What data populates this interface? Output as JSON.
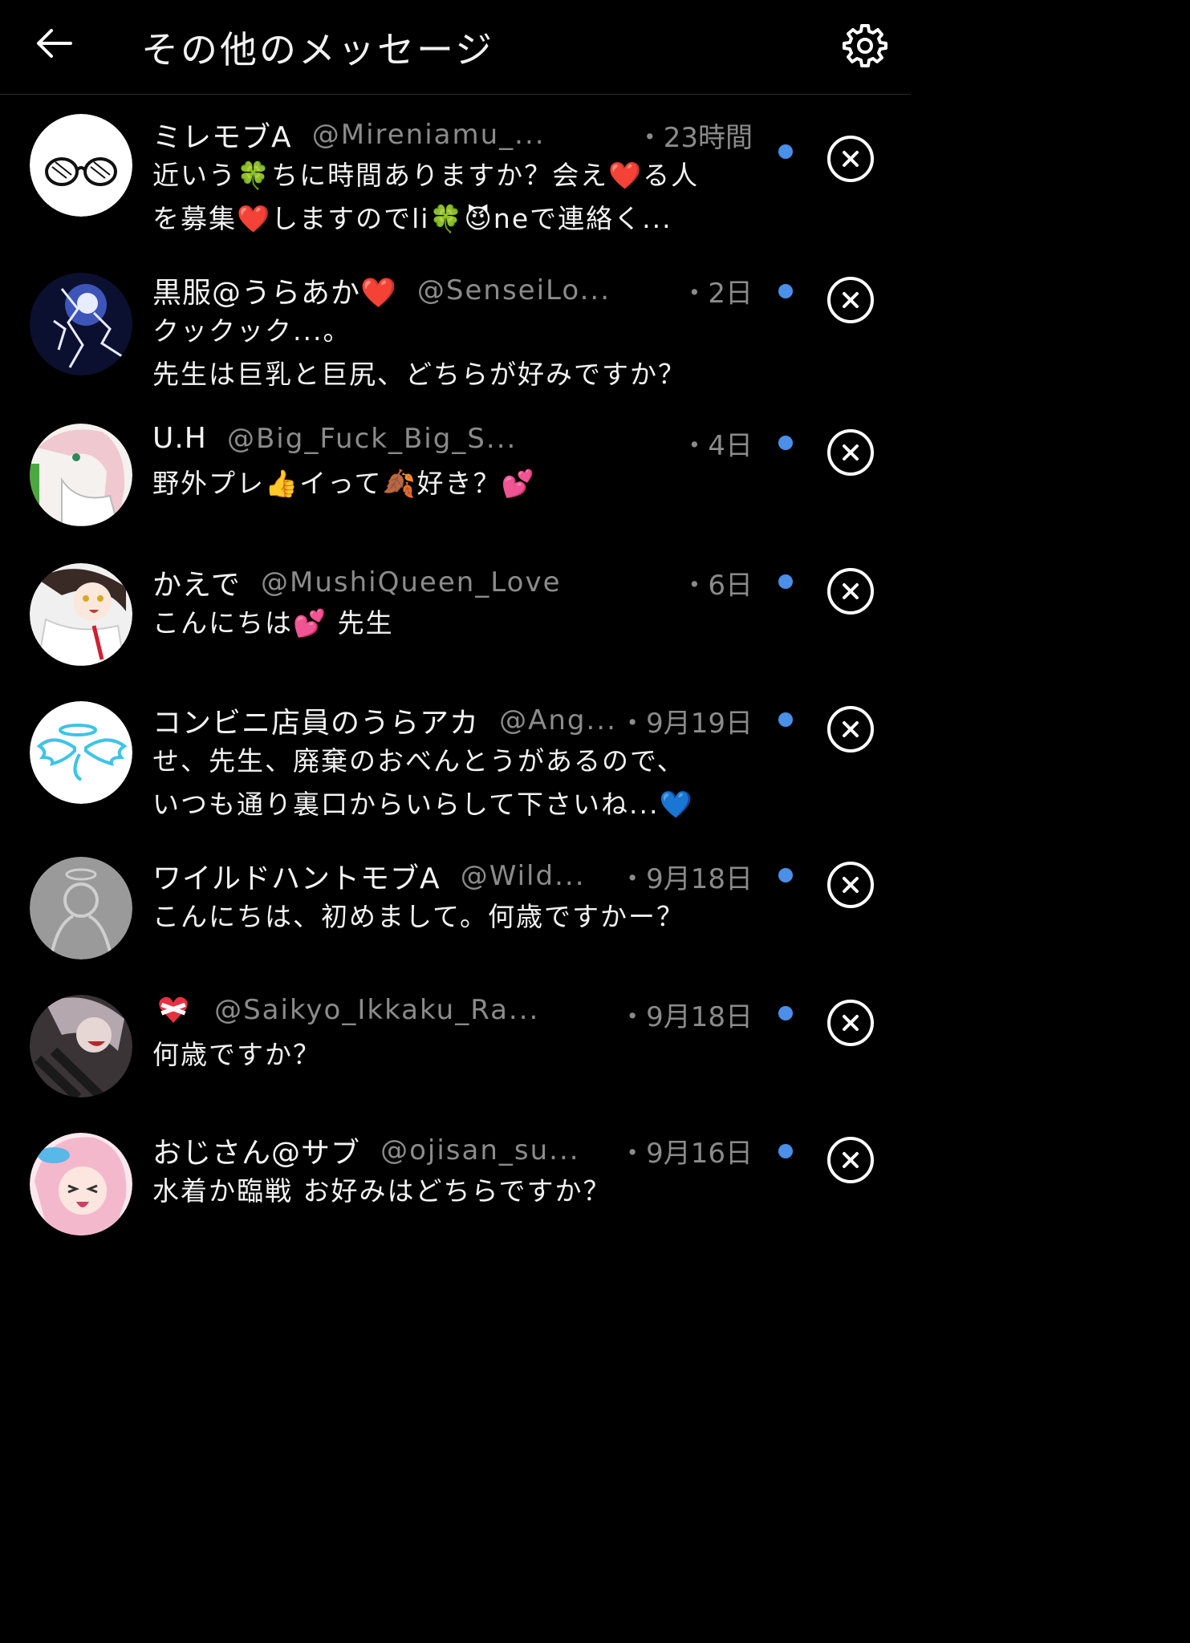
{
  "header": {
    "title": "その他のメッセージ"
  },
  "messages": [
    {
      "name": "ミレモブA",
      "handle": "@Mireniamu_...",
      "time": "・23時間",
      "lines": [
        "近いう🍀ちに時間ありますか？会え❤️る人",
        "を募集❤️しますのでli🍀😈neで連絡く..."
      ]
    },
    {
      "name": "黒服@うらあか❤️",
      "handle": "@SenseiLo...",
      "time": "・2日",
      "lines": [
        "クックック...。",
        "先生は巨乳と巨尻、どちらが好みですか？"
      ]
    },
    {
      "name": "U.H",
      "handle": "@Big_Fuck_Big_S...",
      "time": "・4日",
      "lines": [
        "野外プレ👍イって🍂好き？💕"
      ]
    },
    {
      "name": "かえで",
      "handle": "@MushiQueen_Love",
      "time": "・6日",
      "lines": [
        "こんにちは💕 先生"
      ]
    },
    {
      "name": "コンビニ店員のうらアカ",
      "handle": "@Ang...",
      "time": "・9月19日",
      "lines": [
        "せ、先生、廃棄のおべんとうがあるので、",
        "いつも通り裏口からいらして下さいね...💙"
      ]
    },
    {
      "name": "ワイルドハントモブA",
      "handle": "@Wild...",
      "time": "・9月18日",
      "lines": [
        "こんにちは、初めまして。何歳ですかー？"
      ]
    },
    {
      "name": "",
      "handle": "@Saikyo_Ikkaku_Ra...",
      "time": "・9月18日",
      "lines": [
        "何歳ですか？"
      ]
    },
    {
      "name": "おじさん@サブ",
      "handle": "@ojisan_su...",
      "time": "・9月16日",
      "lines": [
        "水着か臨戦 お好みはどちらですか？"
      ]
    }
  ]
}
